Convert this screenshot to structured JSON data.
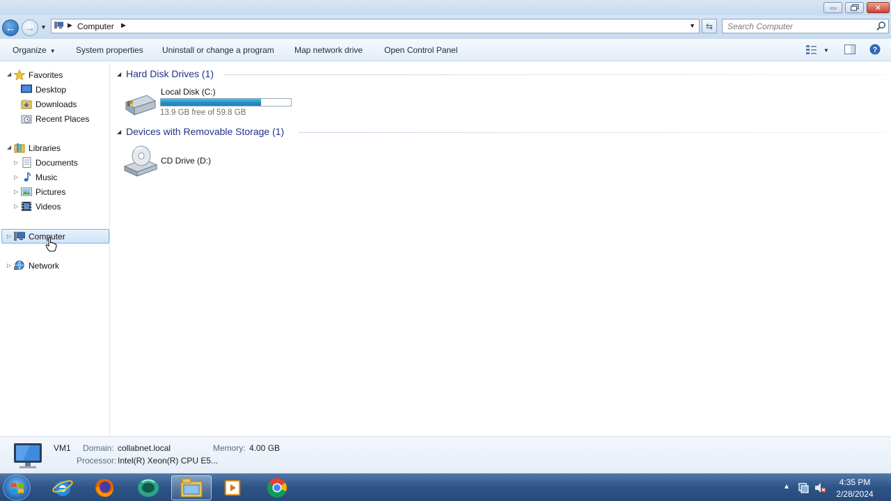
{
  "window": {
    "controls": [
      "minimize-icon",
      "maximize-icon",
      "close-icon"
    ]
  },
  "address": {
    "crumb": "Computer",
    "search_placeholder": "Search Computer"
  },
  "toolbar": {
    "organize": "Organize",
    "system_properties": "System properties",
    "uninstall": "Uninstall or change a program",
    "map_drive": "Map network drive",
    "control_panel": "Open Control Panel"
  },
  "nav": {
    "favorites": "Favorites",
    "desktop": "Desktop",
    "downloads": "Downloads",
    "recent": "Recent Places",
    "libraries": "Libraries",
    "documents": "Documents",
    "music": "Music",
    "pictures": "Pictures",
    "videos": "Videos",
    "computer": "Computer",
    "network": "Network"
  },
  "content": {
    "hard_disks": {
      "title": "Hard Disk Drives (1)",
      "drive_name": "Local Disk (C:)",
      "free_text": "13.9 GB free of 59.8 GB",
      "used_fraction": 0.768
    },
    "removable": {
      "title": "Devices with Removable Storage (1)",
      "drive_name": "CD Drive (D:)"
    }
  },
  "details": {
    "name": "VM1",
    "domain_label": "Domain:",
    "domain_value": "collabnet.local",
    "memory_label": "Memory:",
    "memory_value": "4.00 GB",
    "processor_label": "Processor:",
    "processor_value": "Intel(R) Xeon(R) CPU E5..."
  },
  "taskbar": {
    "apps": [
      "internet-explorer-icon",
      "firefox-icon",
      "app-icon",
      "explorer-icon",
      "media-player-icon",
      "chrome-icon"
    ],
    "time": "4:35 PM",
    "date": "2/28/2024"
  },
  "colors": {
    "group_header": "#1e3287",
    "disk_bar": "#1a8fc4",
    "selection": "#cfe3f9"
  }
}
